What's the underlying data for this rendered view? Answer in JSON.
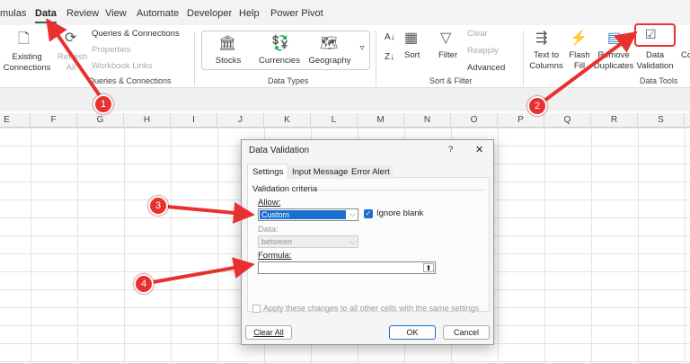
{
  "tabs": [
    "mulas",
    "Data",
    "Review",
    "View",
    "Automate",
    "Developer",
    "Help",
    "Power Pivot"
  ],
  "active_tab": "Data",
  "ribbon": {
    "existing_connections": "Existing Connections",
    "refresh_all": "Refresh All",
    "queries_connections": "Queries & Connections",
    "properties": "Properties",
    "workbook_links": "Workbook Links",
    "group_queries": "Queries & Connections",
    "stocks": "Stocks",
    "currencies": "Currencies",
    "geography": "Geography",
    "group_data_types": "Data Types",
    "sort": "Sort",
    "filter": "Filter",
    "clear": "Clear",
    "reapply": "Reapply",
    "advanced": "Advanced",
    "group_sort_filter": "Sort & Filter",
    "text_to_columns": "Text to Columns",
    "flash_fill": "Flash Fill",
    "remove_duplicates": "Remove Duplicates",
    "data_validation": "Data Validation",
    "consolidate": "Co",
    "group_data_tools": "Data Tools"
  },
  "columns": [
    "E",
    "F",
    "G",
    "H",
    "I",
    "J",
    "K",
    "L",
    "M",
    "N",
    "O",
    "P",
    "Q",
    "R",
    "S"
  ],
  "dialog": {
    "title": "Data Validation",
    "help": "?",
    "close": "✕",
    "tabs": [
      "Settings",
      "Input Message",
      "Error Alert"
    ],
    "criteria": "Validation criteria",
    "allow_label": "Allow:",
    "allow_value": "Custom",
    "ignore_blank": "Ignore blank",
    "ignore_blank_checked": true,
    "data_label": "Data:",
    "data_value": "between",
    "formula_label": "Formula:",
    "formula_value": "",
    "apply_all": "Apply these changes to all other cells with the same settings",
    "clear_all": "Clear All",
    "ok": "OK",
    "cancel": "Cancel"
  },
  "callouts": [
    "1",
    "2",
    "3",
    "4"
  ],
  "accent": "#1e7145",
  "callout_color": "#e8312f"
}
